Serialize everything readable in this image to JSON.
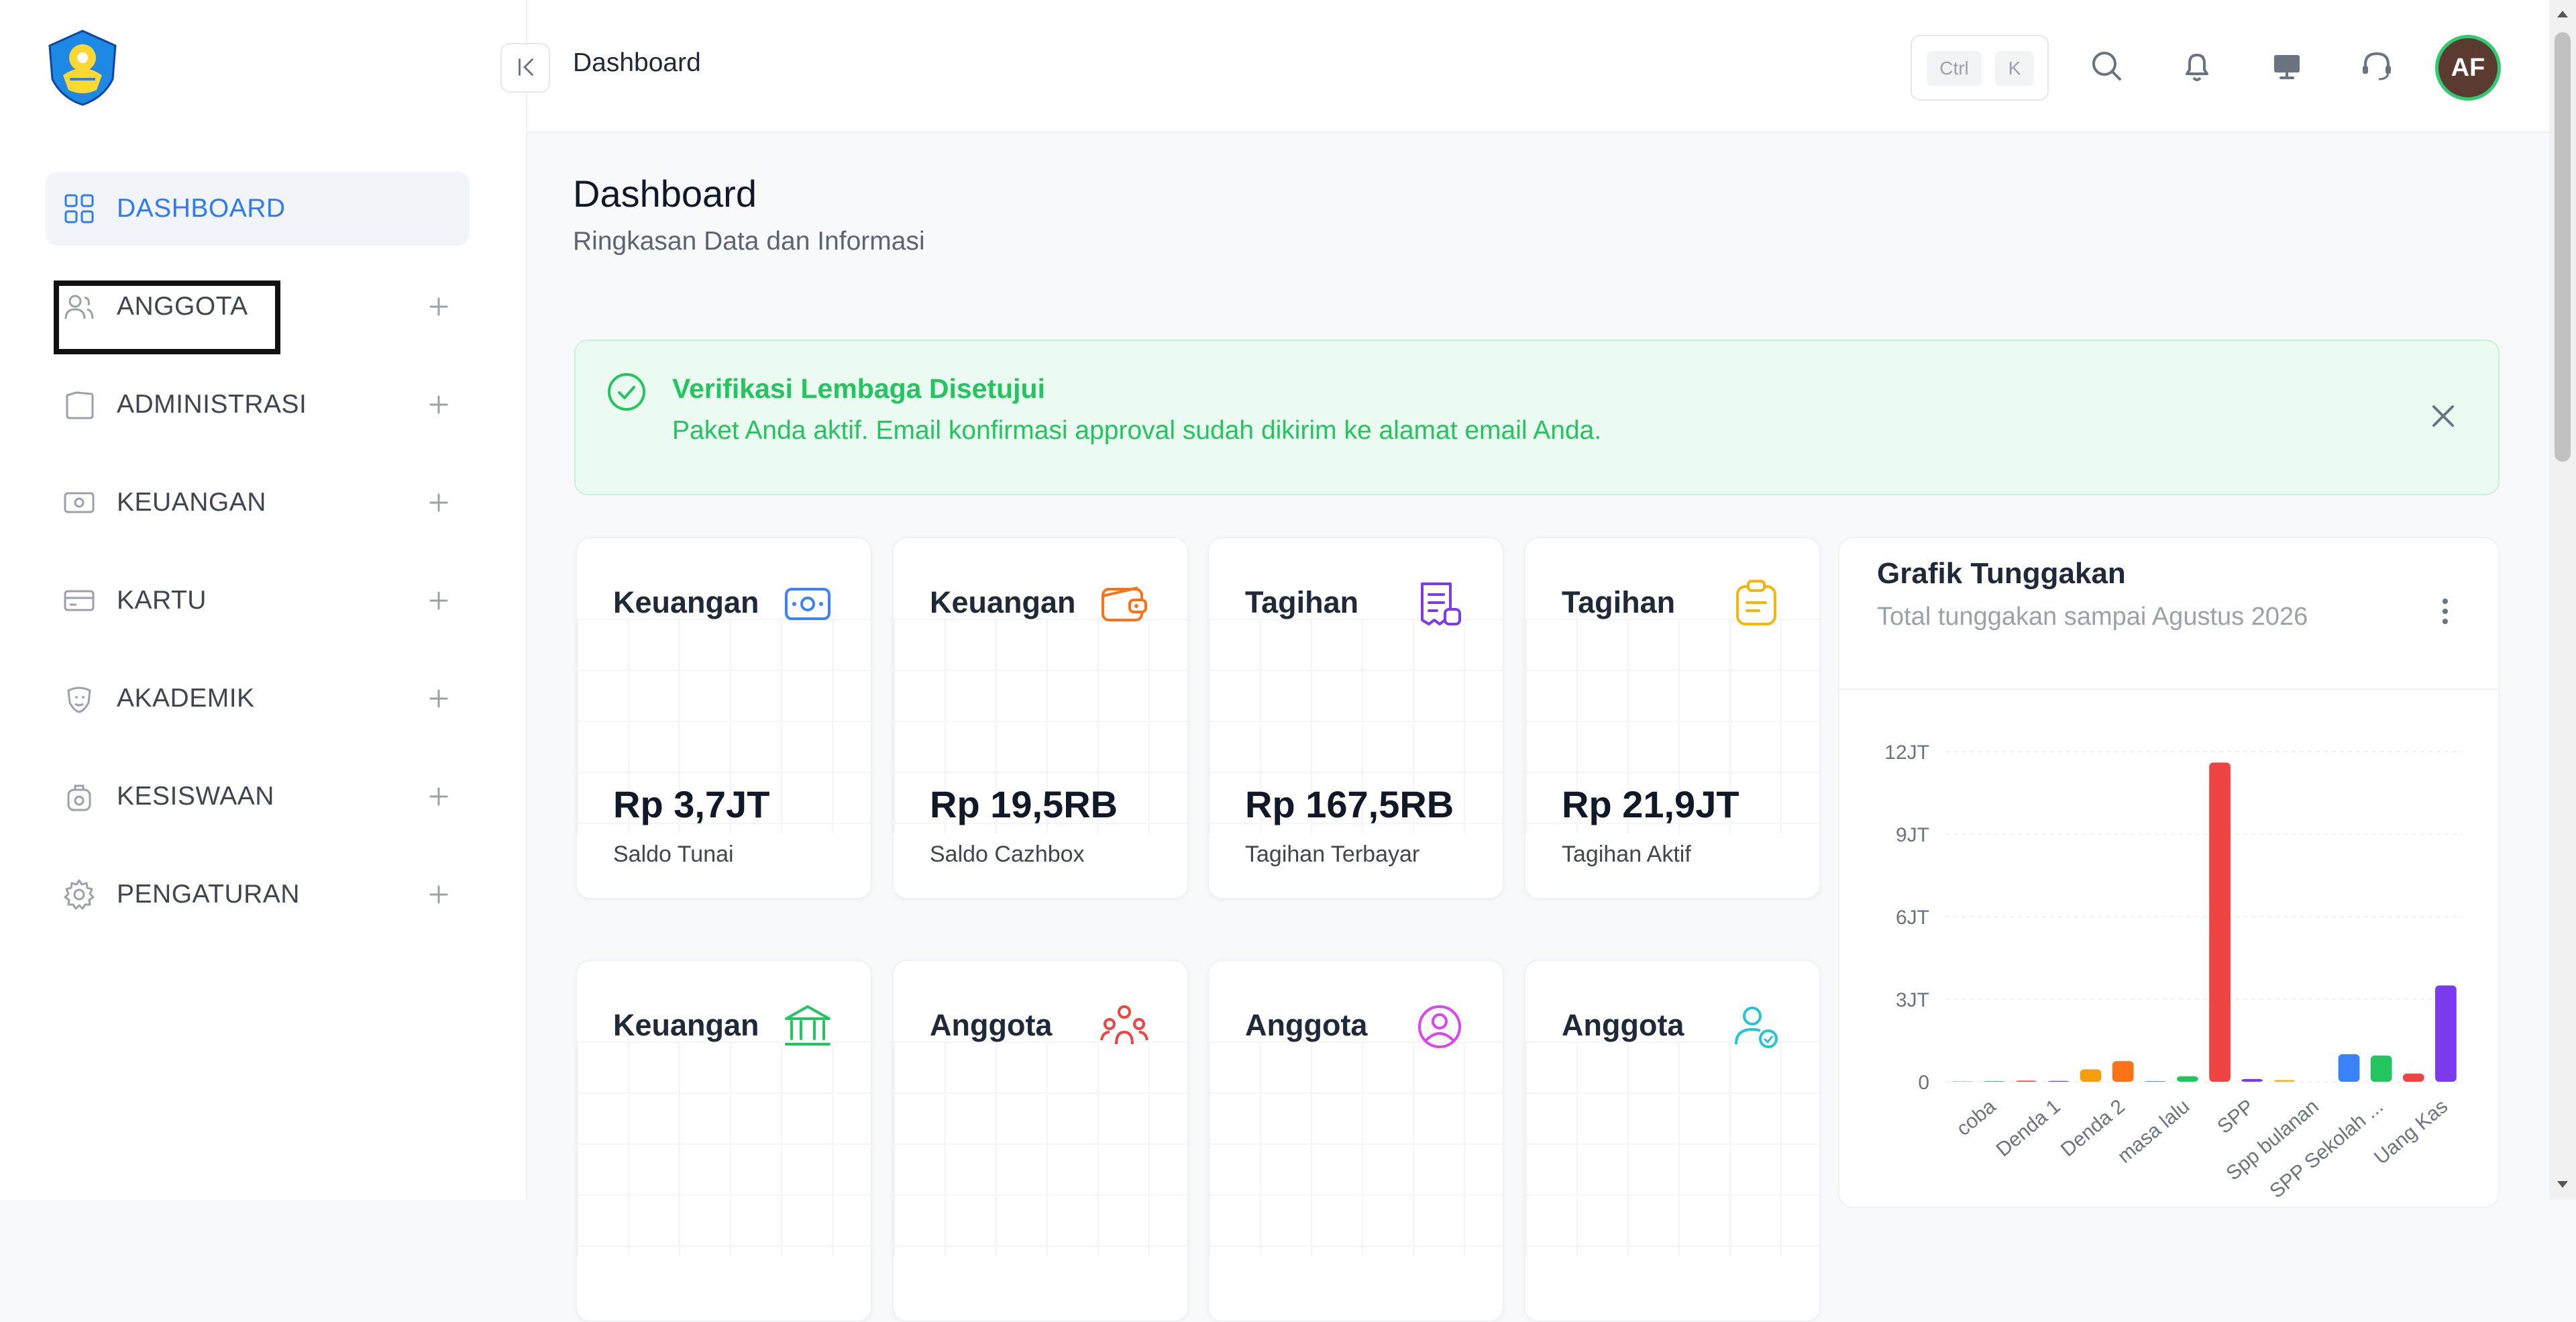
{
  "header": {
    "breadcrumb": "Dashboard",
    "shortcut_keys": [
      "Ctrl",
      "K"
    ],
    "avatar_initials": "AF"
  },
  "sidebar": {
    "items": [
      {
        "label": "DASHBOARD",
        "icon": "grid-icon",
        "active": true
      },
      {
        "label": "ANGGOTA",
        "icon": "users-icon",
        "active": false
      },
      {
        "label": "ADMINISTRASI",
        "icon": "folder-icon",
        "active": false
      },
      {
        "label": "KEUANGAN",
        "icon": "money-icon",
        "active": false
      },
      {
        "label": "KARTU",
        "icon": "card-icon",
        "active": false
      },
      {
        "label": "AKADEMIK",
        "icon": "mask-icon",
        "active": false
      },
      {
        "label": "KESISWAAN",
        "icon": "backpack-icon",
        "active": false
      },
      {
        "label": "PENGATURAN",
        "icon": "gear-icon",
        "active": false
      }
    ]
  },
  "page": {
    "title": "Dashboard",
    "subtitle": "Ringkasan Data dan Informasi"
  },
  "alert": {
    "title": "Verifikasi Lembaga Disetujui",
    "message": "Paket Anda aktif. Email konfirmasi approval sudah dikirim ke alamat email Anda."
  },
  "cards_row1": [
    {
      "title": "Keuangan",
      "value": "Rp 3,7JT",
      "label": "Saldo Tunai",
      "color": "#3b82f6",
      "icon": "cash-icon"
    },
    {
      "title": "Keuangan",
      "value": "Rp 19,5RB",
      "label": "Saldo Cazhbox",
      "color": "#f97316",
      "icon": "wallet-icon"
    },
    {
      "title": "Tagihan",
      "value": "Rp 167,5RB",
      "label": "Tagihan Terbayar",
      "color": "#7c3aed",
      "icon": "receipt-icon"
    },
    {
      "title": "Tagihan",
      "value": "Rp 21,9JT",
      "label": "Tagihan Aktif",
      "color": "#f5b50a",
      "icon": "clipboard-icon"
    }
  ],
  "cards_row2": [
    {
      "title": "Keuangan",
      "color": "#22c55e",
      "icon": "bank-icon"
    },
    {
      "title": "Anggota",
      "color": "#ef4444",
      "icon": "group-icon"
    },
    {
      "title": "Anggota",
      "color": "#d946ef",
      "icon": "user-circle-icon"
    },
    {
      "title": "Anggota",
      "color": "#22c5d6",
      "icon": "user-check-icon"
    }
  ],
  "chart_data": {
    "type": "bar",
    "title": "Grafik Tunggakan",
    "subtitle": "Total tunggakan sampai Agustus 2026",
    "yticks": [
      "12JT",
      "9JT",
      "6JT",
      "3JT",
      "0"
    ],
    "ylim": [
      0,
      12000000
    ],
    "xlabels": [
      "coba",
      "Denda 1",
      "Denda 2",
      "masa lalu",
      "SPP",
      "Spp bulanan",
      "SPP Sekolah ...",
      "Uang Kas"
    ],
    "bars": [
      {
        "value": 10000,
        "color": "#3b82f6"
      },
      {
        "value": 20000,
        "color": "#22c55e"
      },
      {
        "value": 40000,
        "color": "#ef4444"
      },
      {
        "value": 30000,
        "color": "#7c3aed"
      },
      {
        "value": 450000,
        "color": "#f59e0b"
      },
      {
        "value": 750000,
        "color": "#f97316"
      },
      {
        "value": 20000,
        "color": "#3b82f6"
      },
      {
        "value": 200000,
        "color": "#22c55e"
      },
      {
        "value": 11600000,
        "color": "#ef4444"
      },
      {
        "value": 100000,
        "color": "#7c3aed"
      },
      {
        "value": 60000,
        "color": "#f5b50a"
      },
      {
        "value": 0,
        "color": "#f97316"
      },
      {
        "value": 1000000,
        "color": "#3b82f6"
      },
      {
        "value": 950000,
        "color": "#22c55e"
      },
      {
        "value": 300000,
        "color": "#ef4444"
      },
      {
        "value": 3500000,
        "color": "#7c3aed"
      }
    ],
    "grid": true,
    "legend": "none"
  }
}
